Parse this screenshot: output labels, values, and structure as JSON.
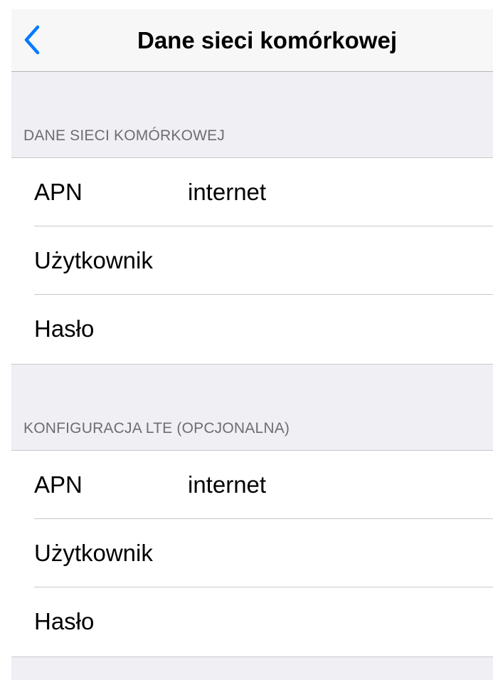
{
  "nav": {
    "title": "Dane sieci komórkowej",
    "back_icon": "chevron-left-icon",
    "accent_color": "#007aff"
  },
  "sections": [
    {
      "header": "DANE SIECI KOMÓRKOWEJ",
      "rows": [
        {
          "label": "APN",
          "value": "internet"
        },
        {
          "label": "Użytkownik",
          "value": ""
        },
        {
          "label": "Hasło",
          "value": ""
        }
      ]
    },
    {
      "header": "KONFIGURACJA LTE (OPCJONALNA)",
      "rows": [
        {
          "label": "APN",
          "value": "internet"
        },
        {
          "label": "Użytkownik",
          "value": ""
        },
        {
          "label": "Hasło",
          "value": ""
        }
      ]
    }
  ],
  "colors": {
    "background": "#efeff4",
    "section_header_text": "#6d6d72",
    "separator": "#c8c7cc"
  }
}
